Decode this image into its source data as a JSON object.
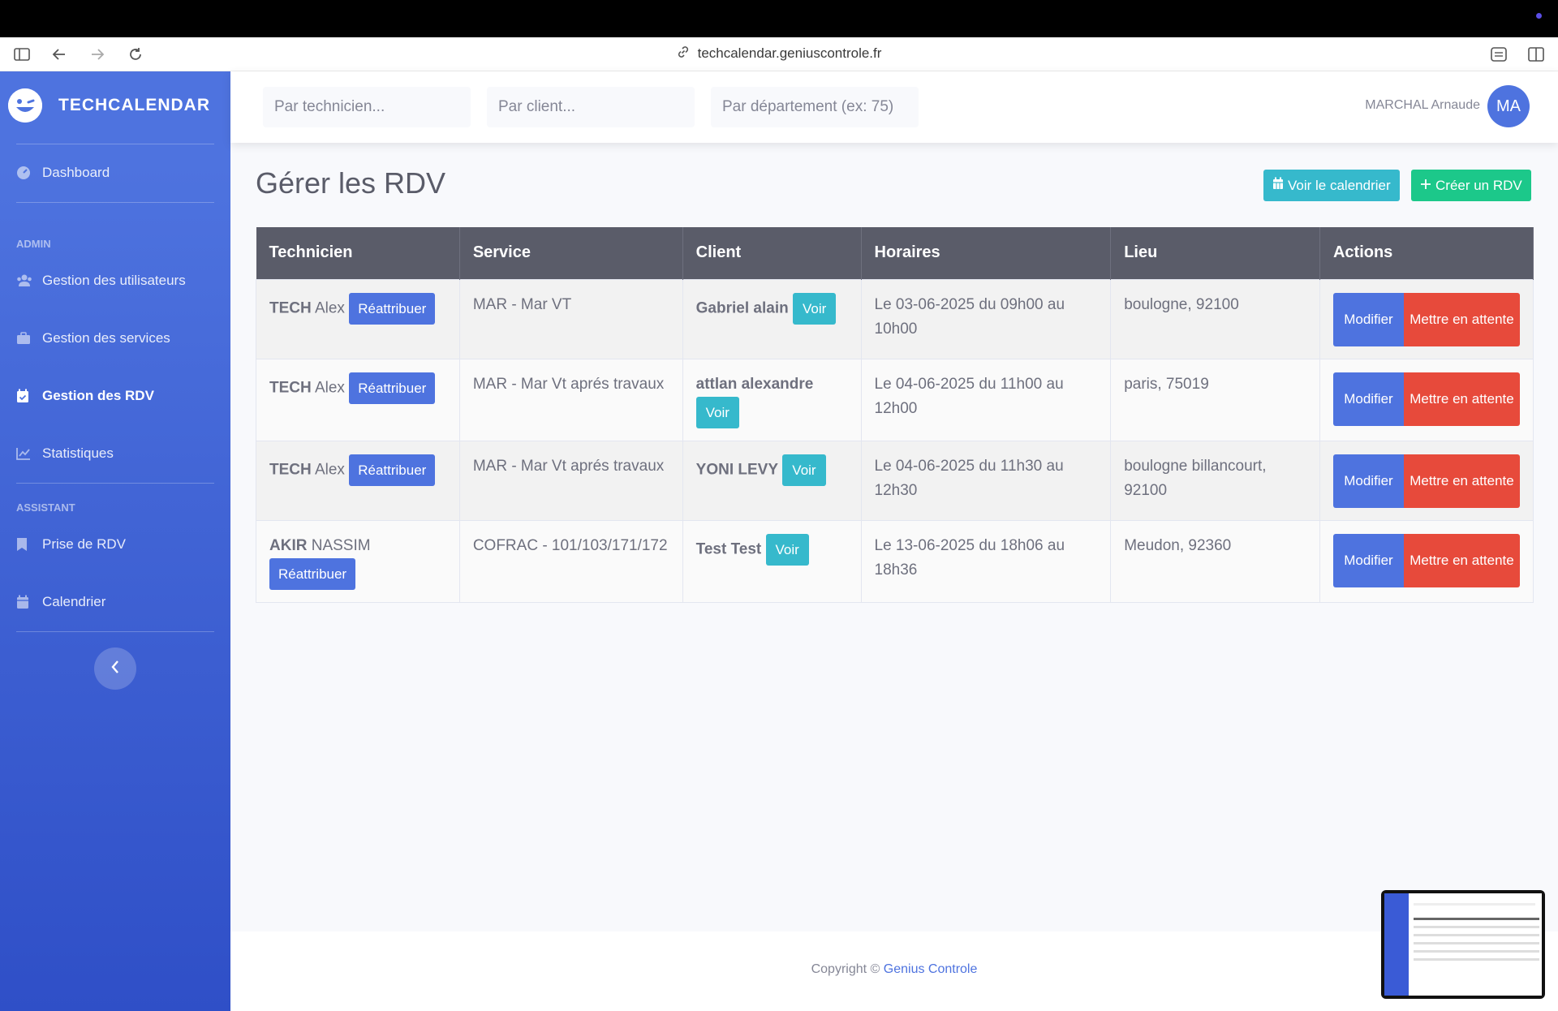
{
  "browser": {
    "url": "techcalendar.geniuscontrole.fr"
  },
  "sidebar": {
    "brand": "TECHCALENDAR",
    "dashboard": "Dashboard",
    "admin_heading": "ADMIN",
    "admin_items": [
      {
        "label": "Gestion des utilisateurs",
        "icon": "users-icon"
      },
      {
        "label": "Gestion des services",
        "icon": "briefcase-icon"
      },
      {
        "label": "Gestion des RDV",
        "icon": "calendar-check-icon",
        "active": true
      },
      {
        "label": "Statistiques",
        "icon": "chart-line-icon"
      }
    ],
    "assistant_heading": "ASSISTANT",
    "assistant_items": [
      {
        "label": "Prise de RDV",
        "icon": "bookmark-icon"
      },
      {
        "label": "Calendrier",
        "icon": "calendar-icon"
      }
    ]
  },
  "topbar": {
    "filters": {
      "technicien_placeholder": "Par technicien...",
      "client_placeholder": "Par client...",
      "departement_placeholder": "Par département (ex: 75)"
    },
    "user_name": "MARCHAL Arnaude",
    "user_initials": "MA"
  },
  "page": {
    "title": "Gérer les RDV",
    "calendar_button": "Voir le calendrier",
    "create_button": "Créer un RDV"
  },
  "table": {
    "headers": [
      "Technicien",
      "Service",
      "Client",
      "Horaires",
      "Lieu",
      "Actions"
    ],
    "reassign_label": "Réattribuer",
    "view_label": "Voir",
    "edit_label": "Modifier",
    "hold_label": "Mettre en attente",
    "rows": [
      {
        "tech_last": "TECH",
        "tech_first": "Alex",
        "service": "MAR - Mar VT",
        "client": "Gabriel alain",
        "horaires": "Le 03-06-2025 du 09h00 au 10h00",
        "lieu": "boulogne, 92100"
      },
      {
        "tech_last": "TECH",
        "tech_first": "Alex",
        "service": "MAR - Mar Vt aprés travaux",
        "client": "attlan alexandre",
        "horaires": "Le 04-06-2025 du 11h00 au 12h00",
        "lieu": "paris, 75019"
      },
      {
        "tech_last": "TECH",
        "tech_first": "Alex",
        "service": "MAR - Mar Vt aprés travaux",
        "client": "YONI LEVY",
        "horaires": "Le 04-06-2025 du 11h30 au 12h30",
        "lieu": "boulogne billancourt, 92100"
      },
      {
        "tech_last": "AKIR",
        "tech_first": "NASSIM",
        "service": "COFRAC - 101/103/171/172",
        "client": "Test Test",
        "horaires": "Le 13-06-2025 du 18h06 au 18h36",
        "lieu": "Meudon, 92360"
      }
    ]
  },
  "footer": {
    "copyright": "Copyright ©",
    "company": "Genius Controle"
  },
  "colors": {
    "primary": "#4e73df",
    "info": "#36b9cc",
    "success": "#1cc88a",
    "danger": "#e74a3b",
    "header_dark": "#5a5c69"
  }
}
